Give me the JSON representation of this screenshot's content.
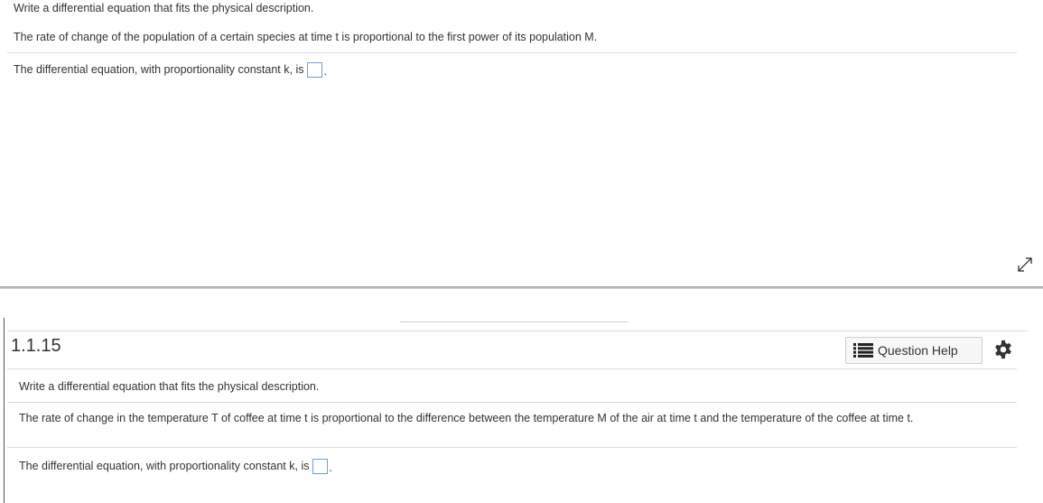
{
  "top": {
    "instruction": "Write a differential equation that fits the physical description.",
    "description": "The rate of change of the population of a certain species at time t is proportional to the first power of its population M.",
    "answer_prompt": "The differential equation, with proportionality constant k, is",
    "answer_value": "",
    "period": "."
  },
  "bottom": {
    "question_number": "1.1.15",
    "help_label": "Question Help",
    "instruction": "Write a differential equation that fits the physical description.",
    "description": "The rate of change in the temperature T of coffee at time t is proportional to the difference between the temperature M of the air at time t and the temperature of the coffee at time t.",
    "answer_prompt": "The differential equation, with proportionality constant k, is",
    "answer_value": "",
    "period": "."
  },
  "icons": {
    "resize": "resize-diagonal-icon",
    "help_list": "list-icon",
    "settings": "gear-icon"
  },
  "colors": {
    "answer_box_border": "#6aa0d8",
    "text": "#333333",
    "rule": "#dcdcdc"
  }
}
